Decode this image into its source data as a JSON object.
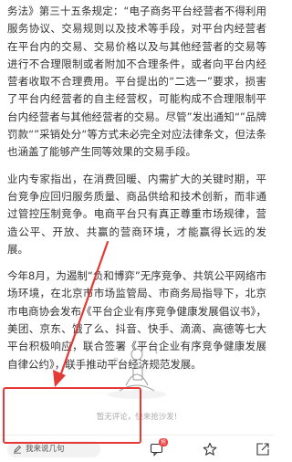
{
  "article": {
    "paragraphs": [
      "务法》第三十五条规定：“电子商务平台经营者不得利用服务协议、交易规则以及技术等手段，对平台内经营者在平台内的交易、交易价格以及与其他经营者的交易等进行不合理限制或者附加不合理条件，或者向平台内经营者收取不合理费用。平台提出的“二选一”要求，损害了平台内经营者的自主经营权，可能构成不合理限制平台内经营者与其他经营者的交易。尽管”发出通知“”品牌罚款“”采销处分“等方式未必完全对应法律条文，但法条也涵盖了能够产生同等效果的交易手段。",
      "业内专家指出，在消费回暖、内需扩大的关键时期，平台竞争应回归服务质量、商品供给和技术创新，而非通过管控压制竞争。电商平台只有真正尊重市场规律，营造公平、开放、共赢的营商环境，才能赢得长远的发展。",
      "今年8月，为遏制“负和博弈”无序竞争、共筑公平网络市场环境，在北京市市场监管局、市商务局指导下，北京市电商协会发布《平台企业有序竞争健康发展倡议书》，美团、京东、饿了么、抖音、快手、滴滴、高德等七大平台积极响应，联合签署《平台企业有序竞争健康发展自律公约》，联手推动平台经济规范发展。"
    ]
  },
  "comments": {
    "empty_text": "暂无评论，快来抢沙发!"
  },
  "bottom_bar": {
    "comment_placeholder": "我来说几句",
    "comment_badge": "抢"
  },
  "colors": {
    "annotation": "#e53935",
    "badge": "#f04142"
  },
  "icons": [
    "pen-icon",
    "comment-icon",
    "star-icon",
    "share-icon"
  ]
}
